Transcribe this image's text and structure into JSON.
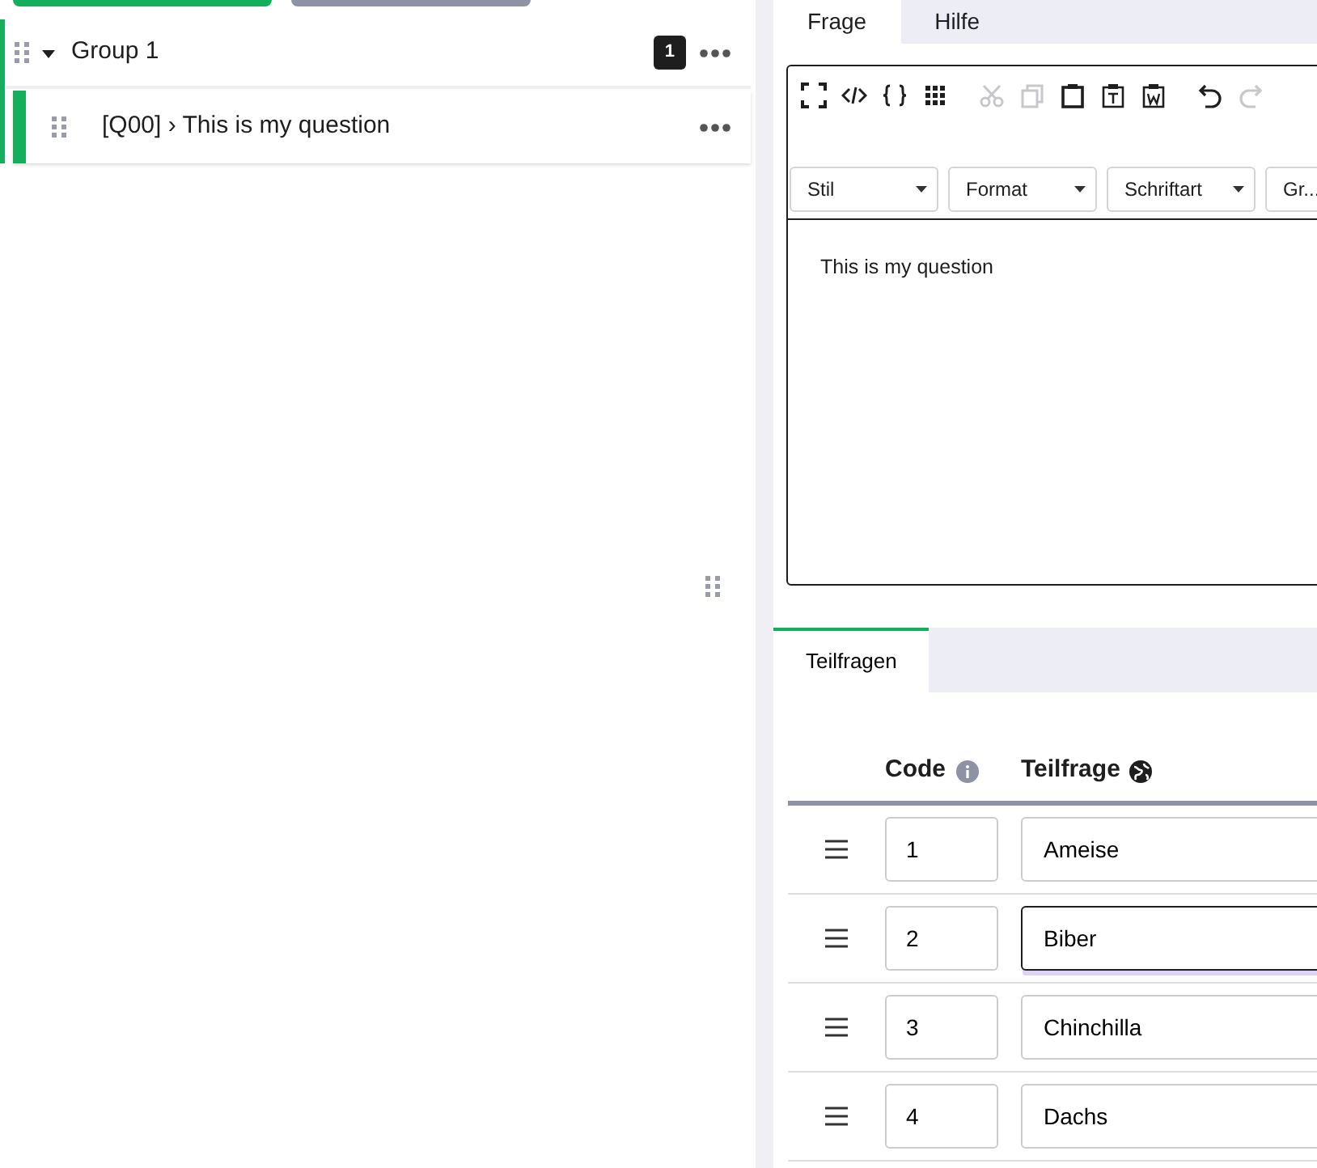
{
  "group": {
    "title": "Group 1",
    "expanded": true,
    "count": "1",
    "questions": [
      {
        "code": "[Q00]",
        "sep": "›",
        "title": "This is my question",
        "selected": true
      }
    ]
  },
  "tabs": [
    {
      "label": "Frage",
      "selected": true
    },
    {
      "label": "Hilfe",
      "selected": false
    }
  ],
  "editor": {
    "toolbar": [
      {
        "kind": "maximize",
        "disabled": false
      },
      {
        "kind": "source",
        "disabled": false
      },
      {
        "kind": "braces",
        "disabled": false
      },
      {
        "kind": "grid",
        "disabled": false
      },
      {
        "kind": "cut",
        "disabled": true
      },
      {
        "kind": "copy",
        "disabled": true
      },
      {
        "kind": "paste",
        "disabled": false
      },
      {
        "kind": "paste-text",
        "disabled": false
      },
      {
        "kind": "paste-word",
        "disabled": false
      },
      {
        "kind": "undo",
        "disabled": false
      },
      {
        "kind": "redo",
        "disabled": true
      }
    ],
    "dropdowns": [
      "Stil",
      "Format",
      "Schriftart",
      "Gr..."
    ],
    "body": "This is my question"
  },
  "subtabs": [
    {
      "label": "Teilfragen",
      "selected": true
    }
  ],
  "table": {
    "columns": [
      "Code",
      "Teilfrage"
    ],
    "rows": [
      {
        "code": "1",
        "text": "Ameise",
        "focused": false
      },
      {
        "code": "2",
        "text": "Biber",
        "focused": true
      },
      {
        "code": "3",
        "text": "Chinchilla",
        "focused": false
      },
      {
        "code": "4",
        "text": "Dachs",
        "focused": false
      }
    ]
  }
}
